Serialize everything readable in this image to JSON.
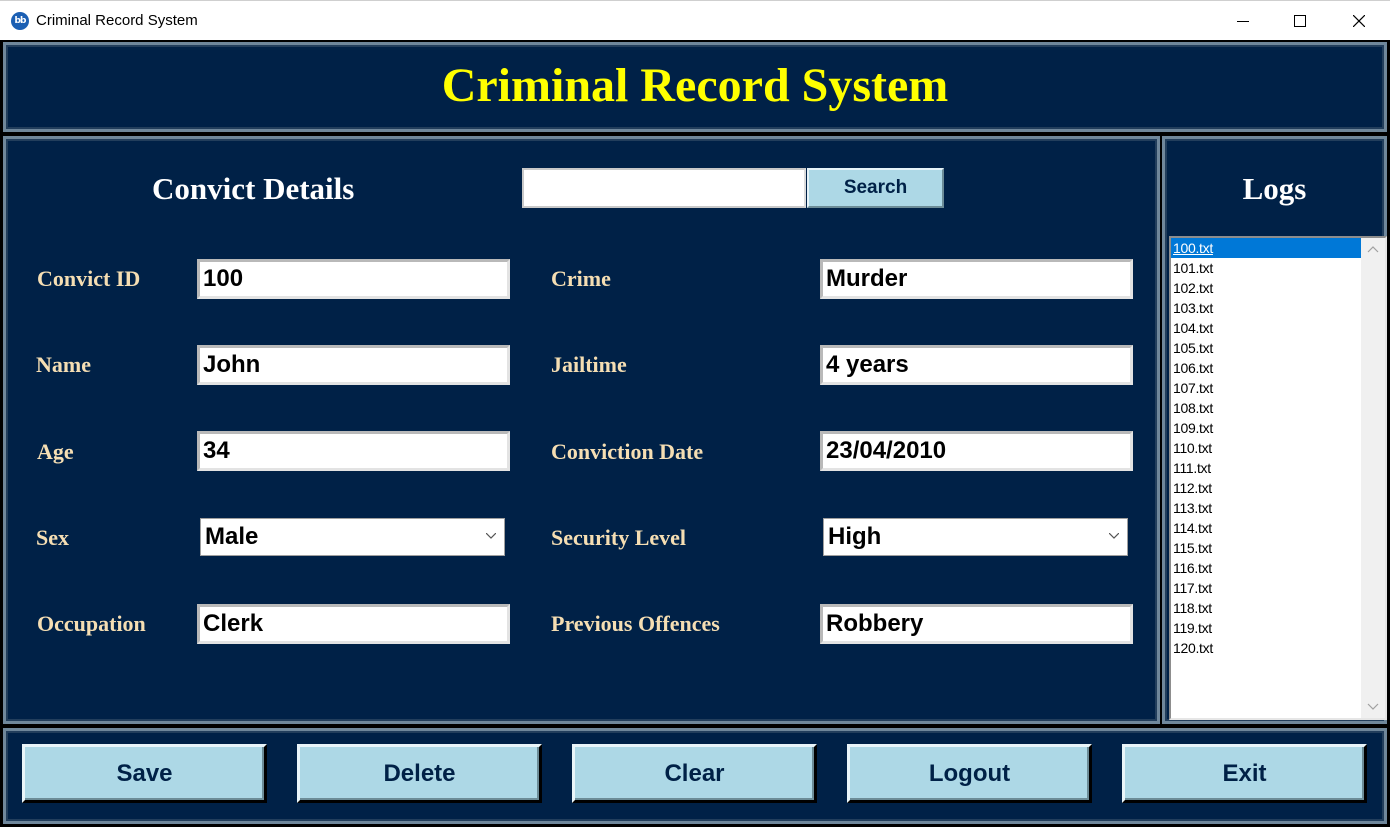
{
  "window": {
    "title": "Criminal Record System",
    "icon": "app-logo-icon"
  },
  "header": {
    "title": "Criminal Record System"
  },
  "convict_section": {
    "title": "Convict Details"
  },
  "search": {
    "value": "",
    "button_label": "Search"
  },
  "form": {
    "convict_id": {
      "label": "Convict ID",
      "value": "100"
    },
    "name": {
      "label": "Name",
      "value": "John"
    },
    "age": {
      "label": "Age",
      "value": "34"
    },
    "sex": {
      "label": "Sex",
      "value": "Male"
    },
    "occupation": {
      "label": "Occupation",
      "value": "Clerk"
    },
    "crime": {
      "label": "Crime",
      "value": "Murder"
    },
    "jailtime": {
      "label": "Jailtime",
      "value": "4 years"
    },
    "conviction_date": {
      "label": "Conviction Date",
      "value": "23/04/2010"
    },
    "security_level": {
      "label": "Security Level",
      "value": "High"
    },
    "previous_offences": {
      "label": "Previous Offences",
      "value": "Robbery"
    }
  },
  "logs": {
    "title": "Logs",
    "selected": "100.txt",
    "items": [
      "100.txt",
      "101.txt",
      "102.txt",
      "103.txt",
      "104.txt",
      "105.txt",
      "106.txt",
      "107.txt",
      "108.txt",
      "109.txt",
      "110.txt",
      "111.txt",
      "112.txt",
      "113.txt",
      "114.txt",
      "115.txt",
      "116.txt",
      "117.txt",
      "118.txt",
      "119.txt",
      "120.txt"
    ]
  },
  "buttons": {
    "save": "Save",
    "delete": "Delete",
    "clear": "Clear",
    "logout": "Logout",
    "exit": "Exit"
  },
  "colors": {
    "panel_bg": "#002147",
    "heading": "#ffff00",
    "label": "#f5deb3",
    "button_bg": "#add8e6",
    "selection": "#0078d7"
  }
}
